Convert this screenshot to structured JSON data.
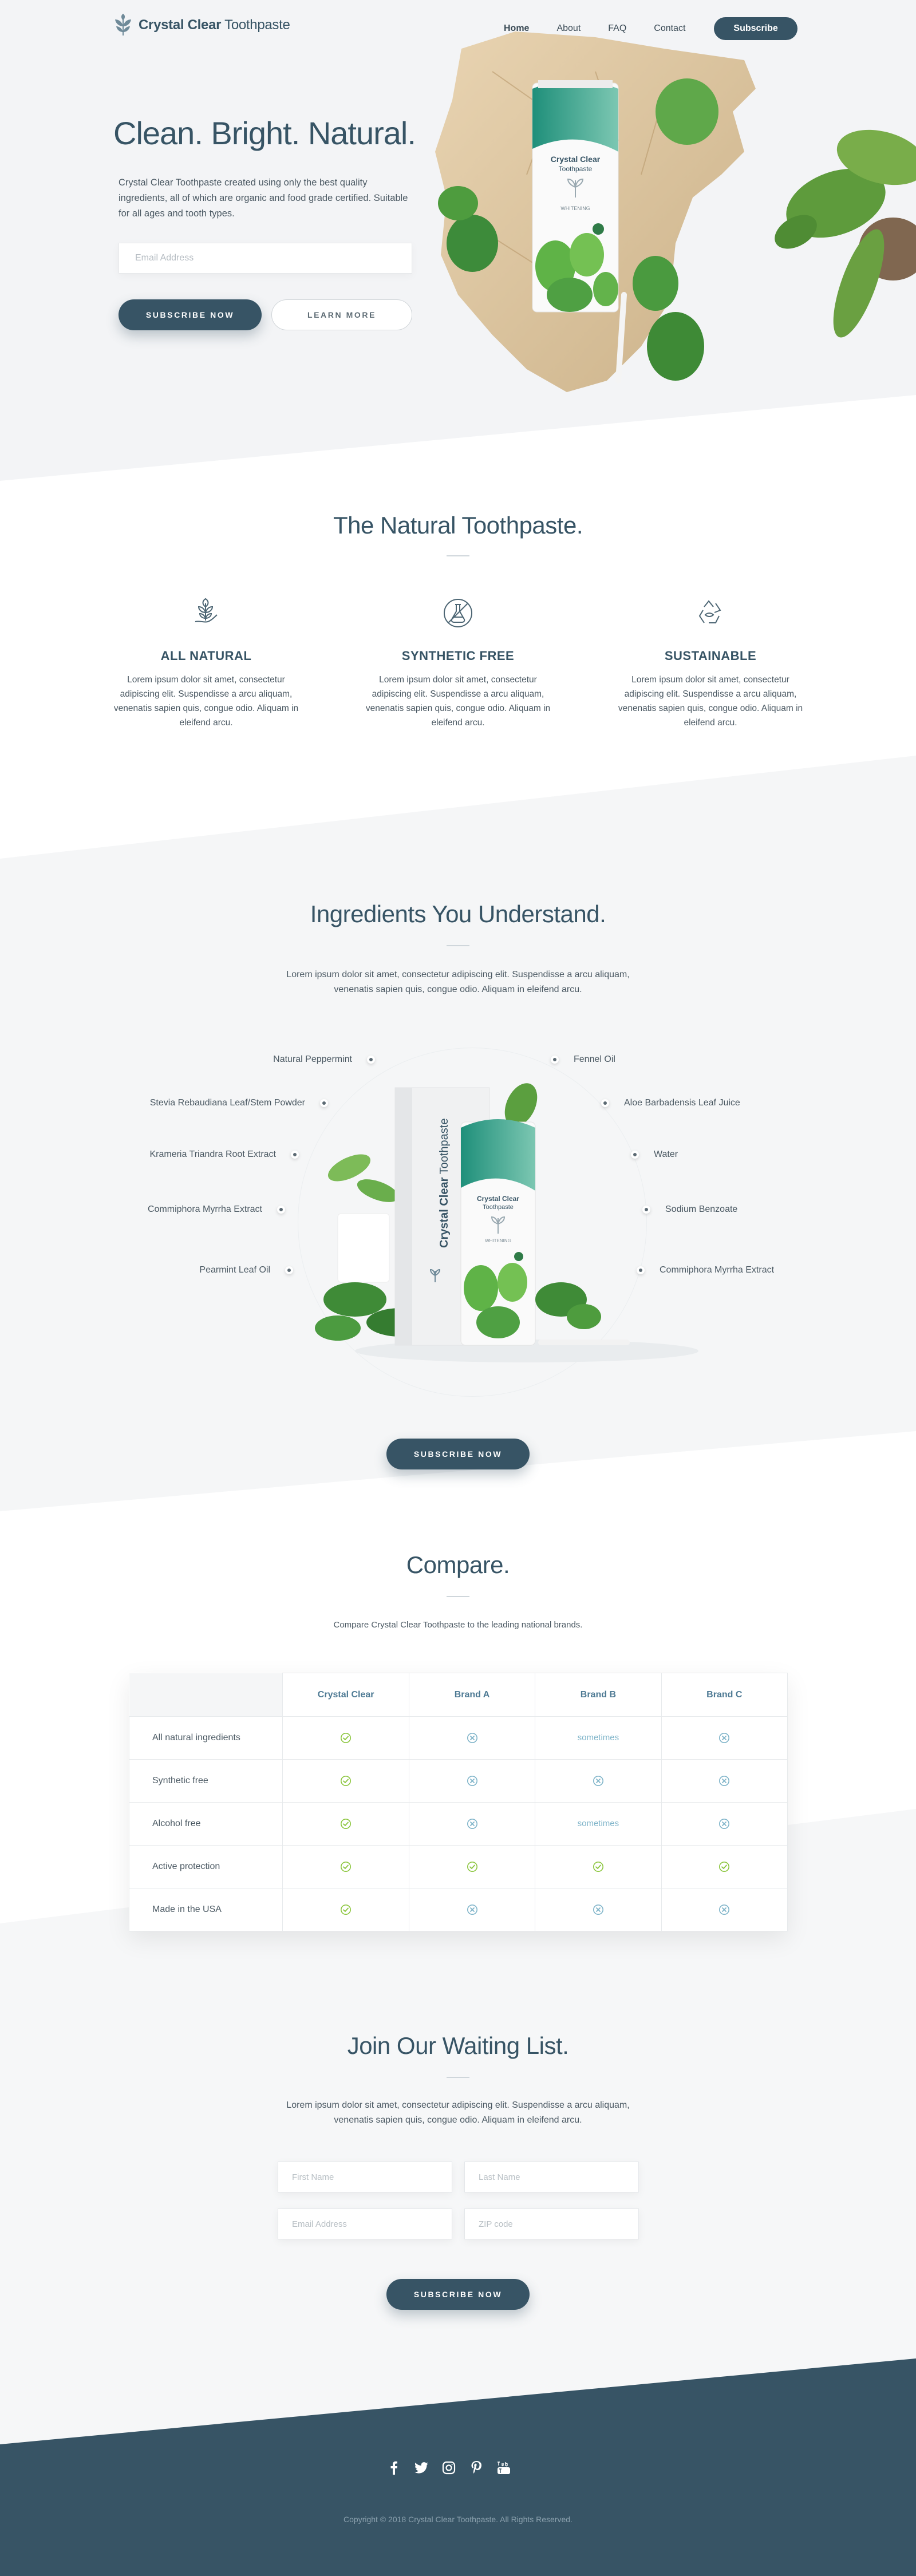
{
  "brand": {
    "name_bold": "Crystal Clear",
    "name_light": "Toothpaste"
  },
  "nav": {
    "items": [
      "Home",
      "About",
      "FAQ",
      "Contact"
    ],
    "subscribe": "Subscribe"
  },
  "hero": {
    "title": "Clean. Bright. Natural.",
    "description": "Crystal Clear Toothpaste created using only the best quality ingredients, all of which are organic and food grade certified. Suitable for all ages and tooth types.",
    "email_placeholder": "Email Address",
    "subscribe_button": "SUBSCRIBE NOW",
    "learn_more_button": "LEARN MORE"
  },
  "product": {
    "tube_brand_bold": "Crystal Clear",
    "tube_brand_light": "Toothpaste",
    "tube_variant": "WHITENING",
    "box_brand_bold": "Crystal Clear",
    "box_brand_light": "Toothpaste"
  },
  "natural": {
    "title": "The Natural Toothpaste.",
    "features": [
      {
        "icon": "leaf-hand-icon",
        "title": "ALL NATURAL",
        "text": "Lorem ipsum dolor sit amet, consectetur adipiscing elit. Suspendisse a arcu aliquam, venenatis sapien quis, congue odio. Aliquam in eleifend arcu."
      },
      {
        "icon": "flask-icon",
        "title": "SYNTHETIC FREE",
        "text": "Lorem ipsum dolor sit amet, consectetur adipiscing elit. Suspendisse a arcu aliquam, venenatis sapien quis, congue odio. Aliquam in eleifend arcu."
      },
      {
        "icon": "recycle-icon",
        "title": "SUSTAINABLE",
        "text": "Lorem ipsum dolor sit amet, consectetur adipiscing elit. Suspendisse a arcu aliquam, venenatis sapien quis, congue odio. Aliquam in eleifend arcu."
      }
    ]
  },
  "ingredients": {
    "title": "Ingredients You Understand.",
    "text": "Lorem ipsum dolor sit amet, consectetur adipiscing elit. Suspendisse a arcu aliquam, venenatis sapien quis, congue odio. Aliquam in eleifend arcu.",
    "left": [
      "Natural Peppermint",
      "Stevia Rebaudiana Leaf/Stem Powder",
      "Krameria Triandra Root Extract",
      "Commiphora Myrrha Extract",
      "Pearmint Leaf Oil"
    ],
    "right": [
      "Fennel Oil",
      "Aloe Barbadensis Leaf Juice",
      "Water",
      "Sodium Benzoate",
      "Commiphora Myrrha Extract"
    ],
    "subscribe_button": "SUBSCRIBE NOW"
  },
  "compare": {
    "title": "Compare.",
    "text": "Compare Crystal Clear Toothpaste to the leading national brands.",
    "columns": [
      "Crystal Clear",
      "Brand A",
      "Brand B",
      "Brand C"
    ],
    "rows": [
      {
        "label": "All natural ingredients",
        "cells": [
          "check",
          "cross",
          "sometimes",
          "cross"
        ]
      },
      {
        "label": "Synthetic free",
        "cells": [
          "check",
          "cross",
          "cross",
          "cross"
        ]
      },
      {
        "label": "Alcohol free",
        "cells": [
          "check",
          "cross",
          "sometimes",
          "cross"
        ]
      },
      {
        "label": "Active protection",
        "cells": [
          "check",
          "check",
          "check",
          "check"
        ]
      },
      {
        "label": "Made in the USA",
        "cells": [
          "check",
          "cross",
          "cross",
          "cross"
        ]
      }
    ],
    "sometimes_text": "sometimes"
  },
  "waitlist": {
    "title": "Join Our Waiting List.",
    "text": "Lorem ipsum dolor sit amet, consectetur adipiscing elit. Suspendisse a arcu aliquam, venenatis sapien quis, congue odio. Aliquam in eleifend arcu.",
    "first_name": "First Name",
    "last_name": "Last Name",
    "email": "Email Address",
    "zip": "ZIP code",
    "subscribe_button": "SUBSCRIBE NOW"
  },
  "footer": {
    "social": [
      "facebook-icon",
      "twitter-icon",
      "instagram-icon",
      "pinterest-icon",
      "youtube-icon"
    ],
    "copyright": "Copyright © 2018 Crystal Clear Toothpaste. All Rights Reserved."
  },
  "colors": {
    "primary": "#375465",
    "accent_green": "#8cc63f",
    "accent_blue": "#7fb4c9"
  }
}
